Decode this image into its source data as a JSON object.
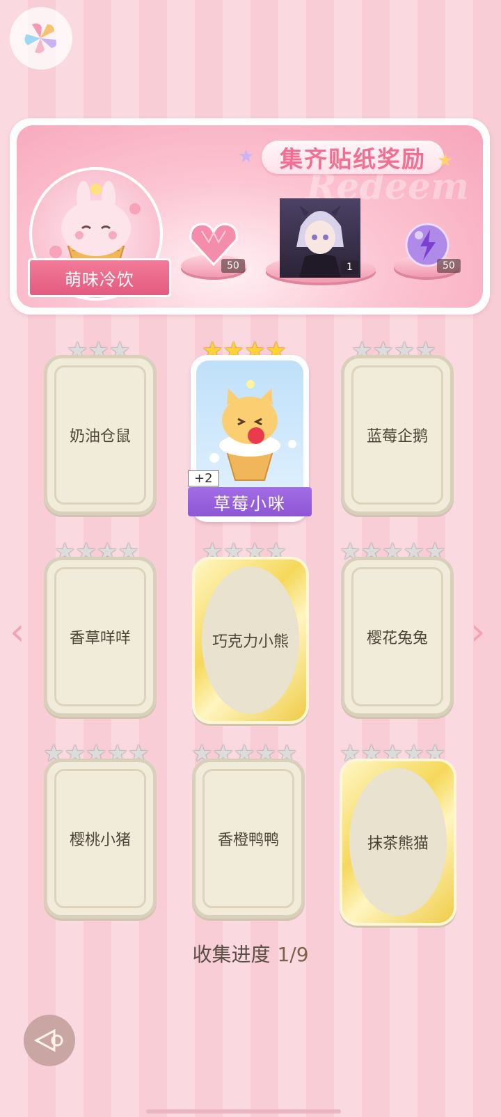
{
  "banner": {
    "title": "集齐贴纸奖励",
    "watermark": "Redeem",
    "theme_name": "萌味冷饮",
    "rewards": [
      {
        "icon": "pink-heart-gem-icon",
        "count": "50"
      },
      {
        "icon": "character-portrait-icon",
        "count": "1"
      },
      {
        "icon": "energy-orb-icon",
        "count": "50"
      }
    ]
  },
  "cards": [
    {
      "name": "奶油仓鼠",
      "stars": 3,
      "star_color": "silver",
      "style": "locked"
    },
    {
      "name": "草莓小咪",
      "stars": 4,
      "star_color": "gold",
      "style": "collected",
      "bonus": "+2"
    },
    {
      "name": "蓝莓企鹅",
      "stars": 4,
      "star_color": "silver",
      "style": "locked"
    },
    {
      "name": "香草咩咩",
      "stars": 4,
      "star_color": "silver",
      "style": "locked"
    },
    {
      "name": "巧克力小熊",
      "stars": 4,
      "star_color": "silver",
      "style": "gold-locked"
    },
    {
      "name": "樱花兔兔",
      "stars": 5,
      "star_color": "silver",
      "style": "locked"
    },
    {
      "name": "樱桃小猪",
      "stars": 5,
      "star_color": "silver",
      "style": "locked"
    },
    {
      "name": "香橙鸭鸭",
      "stars": 5,
      "star_color": "silver",
      "style": "locked"
    },
    {
      "name": "抹茶熊猫",
      "stars": 5,
      "star_color": "silver",
      "style": "gold-locked"
    }
  ],
  "progress": {
    "label": "收集进度",
    "value": "1/9"
  },
  "colors": {
    "accent": "#f06f92",
    "purple": "#9a62d8"
  }
}
